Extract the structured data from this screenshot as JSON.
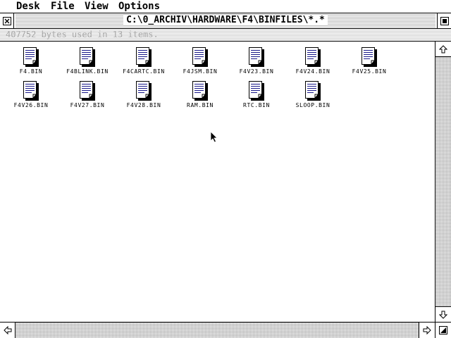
{
  "menu": {
    "items": [
      "Desk",
      "File",
      "View",
      "Options"
    ]
  },
  "window": {
    "title": "C:\\0_ARCHIV\\HARDWARE\\F4\\BINFILES\\*.*",
    "info": "407752 bytes used in 13 items."
  },
  "files": [
    "F4.BIN",
    "F4BLINK.BIN",
    "F4CARTC.BIN",
    "F4JSM.BIN",
    "F4V23.BIN",
    "F4V24.BIN",
    "F4V25.BIN",
    "F4V26.BIN",
    "F4V27.BIN",
    "F4V28.BIN",
    "RAM.BIN",
    "RTC.BIN",
    "SLOOP.BIN"
  ],
  "icons": {
    "close": "close-box-icon",
    "fuller": "fuller-box-icon",
    "file": "document-icon",
    "up": "arrow-up-icon",
    "down": "arrow-down-icon",
    "left": "arrow-left-icon",
    "right": "arrow-right-icon",
    "sizer": "size-box-icon",
    "pointer": "mouse-pointer-icon"
  },
  "colors": {
    "doc_lines": "#1a1a8a",
    "info_text": "#a8a8a8"
  }
}
